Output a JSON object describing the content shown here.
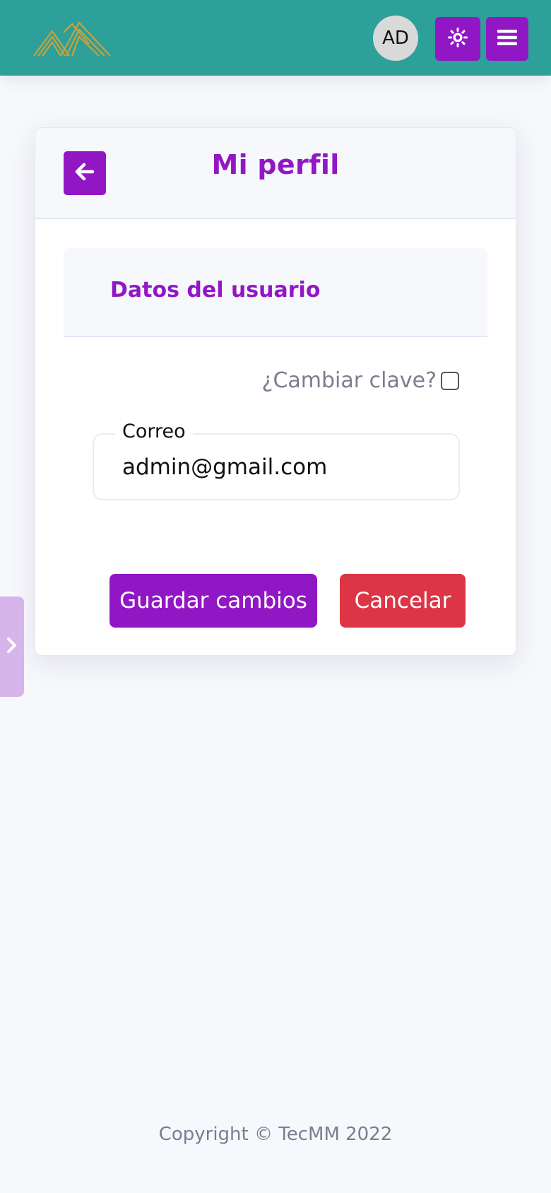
{
  "header": {
    "avatar_initials": "AD",
    "logo_icon": "mountains-logo",
    "theme_icon": "sun-icon",
    "menu_icon": "hamburger-menu-icon",
    "brand_color": "#2da09a",
    "accent_color": "#9217c4"
  },
  "card": {
    "back_icon": "arrow-left-icon",
    "title": "Mi perfil",
    "section_title": "Datos del usuario",
    "change_password_label": "¿Cambiar clave?",
    "change_password_checked": false,
    "email_label": "Correo",
    "email_value": "admin@gmail.com",
    "save_label": "Guardar cambios",
    "cancel_label": "Cancelar",
    "cancel_color": "#dc3545"
  },
  "sidebar_toggle": {
    "icon": "chevron-right-icon"
  },
  "footer": {
    "copyright": "Copyright © TecMM 2022"
  }
}
